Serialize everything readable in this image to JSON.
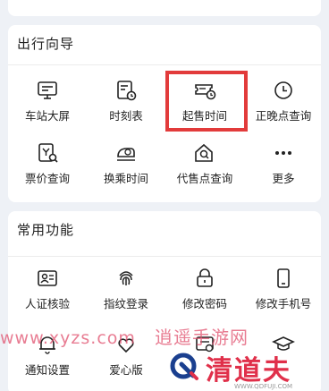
{
  "guide": {
    "title": "出行向导",
    "items": [
      {
        "label": "车站大屏",
        "icon": "station-screen-icon"
      },
      {
        "label": "时刻表",
        "icon": "timetable-icon"
      },
      {
        "label": "起售时间",
        "icon": "ticket-clock-icon"
      },
      {
        "label": "正晚点查询",
        "icon": "clock-icon"
      },
      {
        "label": "票价查询",
        "icon": "ticket-price-search-icon"
      },
      {
        "label": "换乘时间",
        "icon": "train-transfer-icon"
      },
      {
        "label": "代售点查询",
        "icon": "agency-search-icon"
      },
      {
        "label": "更多",
        "icon": "more-dots-icon"
      }
    ],
    "highlighted": "起售时间"
  },
  "common": {
    "title": "常用功能",
    "items": [
      {
        "label": "人证核验",
        "icon": "id-verify-icon"
      },
      {
        "label": "指纹登录",
        "icon": "fingerprint-icon"
      },
      {
        "label": "修改密码",
        "icon": "lock-icon"
      },
      {
        "label": "修改手机号",
        "icon": "phone-icon"
      },
      {
        "label": "通知设置",
        "icon": "bell-icon"
      },
      {
        "label": "爱心版",
        "icon": "heart-icon"
      },
      {
        "label": "",
        "icon": "card-icon"
      },
      {
        "label": "",
        "icon": "graduation-cap-icon"
      }
    ]
  },
  "watermark": {
    "site": "www.xyzs.com",
    "name": "逍遥手游网"
  },
  "brand": {
    "name": "清道夫",
    "url": "WWW.QDFUJI.COM"
  },
  "colors": {
    "highlight": "#e23b3b",
    "background": "#eef1f6",
    "brand": "#e0304a"
  }
}
